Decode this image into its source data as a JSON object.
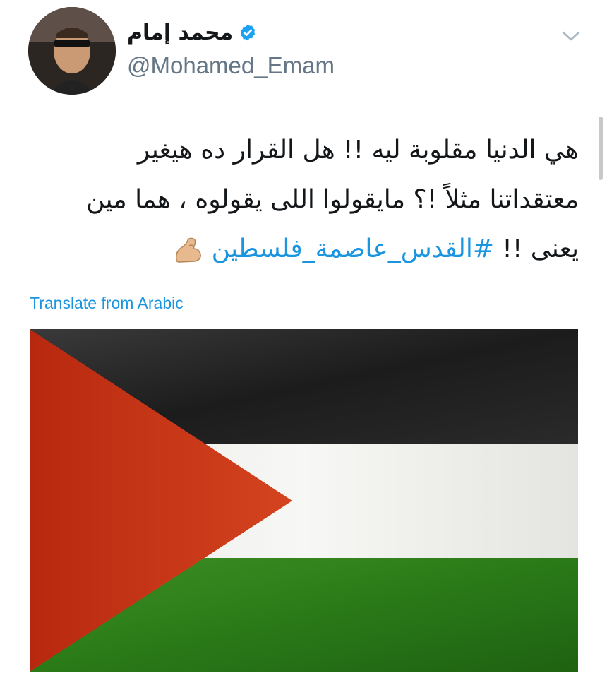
{
  "tweet": {
    "author": {
      "display_name": "محمد إمام",
      "handle": "@Mohamed_Emam",
      "verified": true
    },
    "text_lines": [
      "هي الدنيا مقلوبة ليه !! هل القرار ده هيغير",
      "معتقداتنا مثلاً !؟ مايقولوا اللى يقولوه ، هما مين",
      "يعنى !! "
    ],
    "hashtag": "#القدس_عاصمة_فلسطين",
    "emoji": "flexed-biceps-emoji",
    "translate_label": "Translate from Arabic",
    "menu_icon": "chevron-down-icon",
    "media": {
      "description_icon": "palestinian-flag-image"
    }
  },
  "colors": {
    "link": "#1b95e0",
    "verified": "#1da1f2",
    "text": "#14171a",
    "secondary": "#657786",
    "flag_black": "#1a1a1a",
    "flag_white": "#f4f4f2",
    "flag_green": "#2f7d1f",
    "flag_red": "#c8321a"
  }
}
